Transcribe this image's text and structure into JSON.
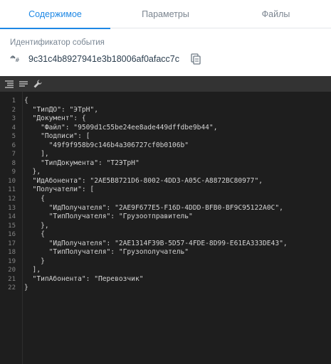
{
  "tabs": [
    {
      "label": "Содержимое",
      "active": true
    },
    {
      "label": "Параметры",
      "active": false
    },
    {
      "label": "Файлы",
      "active": false
    }
  ],
  "event": {
    "label": "Идентификатор события",
    "id": "9c31c4b8927941e3b18006af0afacc7c"
  },
  "icons": {
    "event_icon": "signal-hash-icon",
    "copy": "copy-icon",
    "format": "format-icon",
    "compact": "compact-icon",
    "tools": "wrench-icon"
  },
  "colors": {
    "accent": "#1e88e5",
    "editor_bg": "#1e1e1e",
    "toolbar_bg": "#333333"
  },
  "code": {
    "lines": [
      "{",
      "  \"ТипДО\": \"ЭТрН\",",
      "  \"Документ\": {",
      "    \"Файл\": \"9509d1c55be24ee8ade449dffdbe9b44\",",
      "    \"Подписи\": [",
      "      \"49f9f958b9c146b4a306727cf0b0106b\"",
      "    ],",
      "    \"ТипДокумента\": \"Т2ЭТрН\"",
      "  },",
      "  \"ИдАбонента\": \"2AE5B8721D6-8002-4DD3-A05C-A8872BC80977\",",
      "  \"Получатели\": [",
      "    {",
      "      \"ИдПолучателя\": \"2AE9F677E5-F16D-4DDD-BFB0-BF9C95122A0C\",",
      "      \"ТипПолучателя\": \"Грузоотправитель\"",
      "    },",
      "    {",
      "      \"ИдПолучателя\": \"2AE1314F39B-5D57-4FDE-8D99-E61EA333DE43\",",
      "      \"ТипПолучателя\": \"Грузополучатель\"",
      "    }",
      "  ],",
      "  \"ТипАбонента\": \"Перевозчик\"",
      "}"
    ]
  }
}
